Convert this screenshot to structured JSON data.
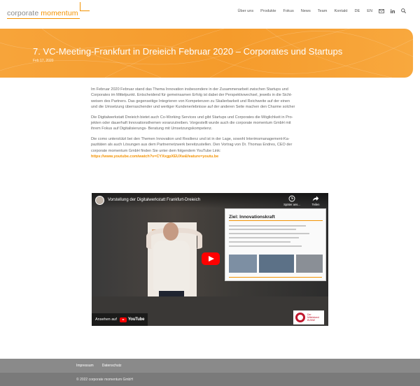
{
  "header": {
    "logo": {
      "word1": "corporate",
      "word2": "momentum"
    },
    "nav": [
      {
        "label": "Über uns"
      },
      {
        "label": "Produkte"
      },
      {
        "label": "Fokus"
      },
      {
        "label": "News"
      },
      {
        "label": "Team"
      },
      {
        "label": "Kontakt"
      },
      {
        "label": "DE"
      },
      {
        "label": "EN"
      }
    ],
    "icons": [
      "mail-icon",
      "linkedin-icon",
      "search-icon"
    ]
  },
  "post": {
    "title": "7. VC-Meeting-Frankfurt in Dreieich Februar 2020 – Corporates und Startups",
    "date": "Feb 17, 2020",
    "paragraphs": [
      [
        "Im Februar 2020 Februar stand das Thema Innovation insbesondere in der Zusammenarbeit zwischen Startups und",
        "Corporates im Mittelpunkt. Entscheidend für gemeinsamen Erfolg ist dabei der Perspektivwechsel, jeweils in die Sicht-",
        "weisen des Partners. Das gegenseitige Integrieren von Kompetenzen zu Skalierbarkeit und Reichweite auf der einen",
        "und die Umsetzung überraschender und wertiger Kundenerlebnisse auf der anderen Seite machen den Charme solcher"
      ],
      [
        "Die Digitalwerkstatt Dreieich bietet auch Co-Working Services und gibt Startups und Corporates die Möglichkeit in Pro-",
        "jekten oder dauerhaft Innovationsthemen voranzutreiben. Vorgestellt wurde auch die corporate momentum GmbH mit",
        "ihrem Fokus auf Digitalisierungs- Beratung mit Umsetzungskompetenz."
      ],
      [
        "Die como unterstützt bei den Themen Innovation und Resilienz und ist in der Lage, sowohl Interimsmanagement-Ka-",
        "pazitäten als auch Lösungen aus dem Partnernetzwerk bereitzustellen. Den Vortrag von Dr. Thomas Endres, CEO der",
        "corporate momentum GmbH finden Sie unter dem folgendem YouTube Link:"
      ]
    ],
    "youtube_link": "https://www.youtube.com/watch?v=CYXxgpXEUXw&feature=youtu.be"
  },
  "video": {
    "title": "Vorstellung der Digitalwerkstatt Frankfurt-Dreieich",
    "watch_later": "Später ans...",
    "share": "Teilen",
    "watch_on": "Ansehen auf",
    "yt_brand": "YouTube",
    "slide_title": "Ziel: Innovationskraft",
    "logo_box_text": [
      "Der",
      "Mittelstand",
      "BVMW"
    ]
  },
  "footer": {
    "links": [
      "Impressum",
      "Datenschutz"
    ],
    "copyright": "© 2022 corporate momentum GmbH"
  },
  "colors": {
    "accent": "#f39200",
    "banner": "#f59b2b",
    "footer": "#8a8a8a",
    "youtube_red": "#ff0000"
  }
}
